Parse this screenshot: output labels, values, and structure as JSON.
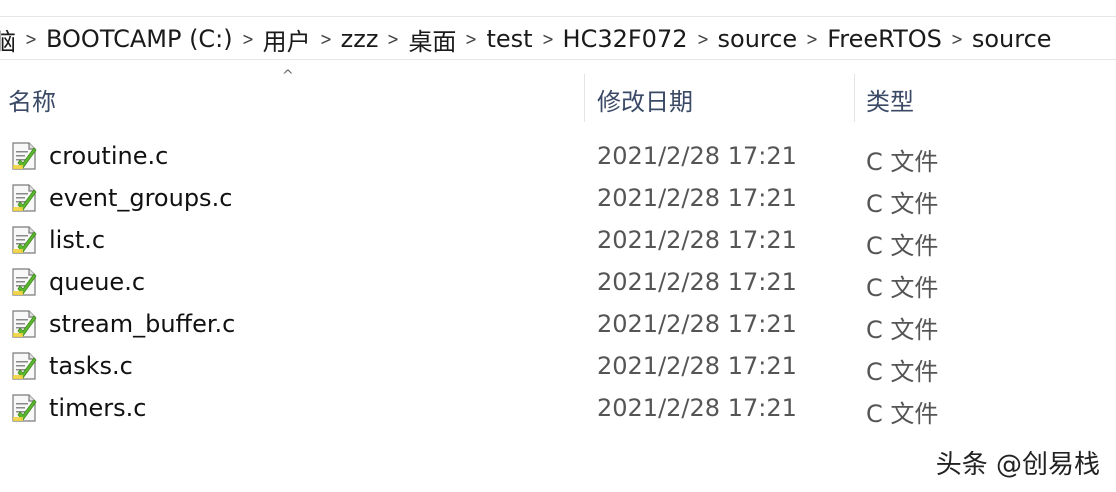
{
  "breadcrumb": [
    {
      "label": "脑"
    },
    {
      "label": "BOOTCAMP (C:)"
    },
    {
      "label": "用户"
    },
    {
      "label": "zzz"
    },
    {
      "label": "桌面"
    },
    {
      "label": "test"
    },
    {
      "label": "HC32F072"
    },
    {
      "label": "source"
    },
    {
      "label": "FreeRTOS"
    },
    {
      "label": "source"
    }
  ],
  "columns": {
    "name": "名称",
    "date": "修改日期",
    "type": "类型",
    "sort_indicator": "^"
  },
  "files": [
    {
      "name": "croutine.c",
      "date": "2021/2/28 17:21",
      "type": "C 文件",
      "icon": "c-file-icon"
    },
    {
      "name": "event_groups.c",
      "date": "2021/2/28 17:21",
      "type": "C 文件",
      "icon": "c-file-icon"
    },
    {
      "name": "list.c",
      "date": "2021/2/28 17:21",
      "type": "C 文件",
      "icon": "c-file-icon"
    },
    {
      "name": "queue.c",
      "date": "2021/2/28 17:21",
      "type": "C 文件",
      "icon": "c-file-icon"
    },
    {
      "name": "stream_buffer.c",
      "date": "2021/2/28 17:21",
      "type": "C 文件",
      "icon": "c-file-icon"
    },
    {
      "name": "tasks.c",
      "date": "2021/2/28 17:21",
      "type": "C 文件",
      "icon": "c-file-icon"
    },
    {
      "name": "timers.c",
      "date": "2021/2/28 17:21",
      "type": "C 文件",
      "icon": "c-file-icon"
    }
  ],
  "watermark": "头条 @创易栈",
  "colors": {
    "header_text": "#3a4a66",
    "icon_green": "#5cb82e",
    "icon_yellow": "#f2d23c"
  }
}
